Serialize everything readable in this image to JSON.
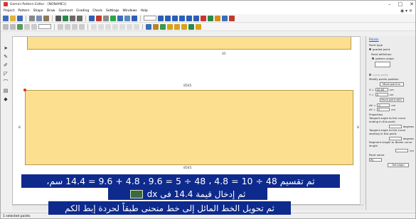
{
  "window": {
    "title": "Gemini Pattern Editor - [NONAME1]",
    "controls": [
      "–",
      "□",
      "✕"
    ]
  },
  "menu": {
    "items": [
      "Project",
      "Pattern",
      "Shape",
      "Draw",
      "Garment",
      "Grading",
      "Check",
      "Settings",
      "Windows",
      "Help"
    ]
  },
  "canvas": {
    "top_piece_label": "45",
    "main_piece_top_label": "8565",
    "main_piece_bottom_label": "8565",
    "left_marker": "8",
    "right_marker": "8"
  },
  "panel": {
    "title": "Points",
    "point_type_label": "Point type",
    "graded_point": "graded point",
    "point_definition": "Point definition",
    "pattern_origin": "pattern origin",
    "curve_point_label": "curve point",
    "modify_label": "Modify points position",
    "move_point_to": "Move point to",
    "x_label": "X =",
    "x_value": "40,63",
    "y_label": "Y =",
    "y_value": "0",
    "unit": "cm",
    "move_point_with": "Move point with",
    "dx_label": "dX =",
    "dx_value": "0",
    "dy_label": "dY =",
    "dy_value": "0",
    "properties": "Properties",
    "tangent_in_label": "Tangent angle to the curve ending in this point",
    "tangent_out_label": "Tangent angle to the curve starting in this point",
    "degrees": "degrees",
    "segment_label": "Segment length or Bezier curve length",
    "point_name_label": "Point name",
    "point_name_value": "P0",
    "set_origin": "Set origin"
  },
  "status": {
    "text": "1 selected points"
  },
  "captions": {
    "line1": "ثم تقسيم 48 ÷ 10 = 4.8 ، 48 ÷ 5 = 9.6 ، 4.8 + 9.6 = 14.4 سم،",
    "line2": "ثم إدخال قيمة 14.4 فى dx",
    "line3": "ثم تحويل الخط المائل إلى خط منحنى طبقاً لحردة إبط الكم"
  }
}
